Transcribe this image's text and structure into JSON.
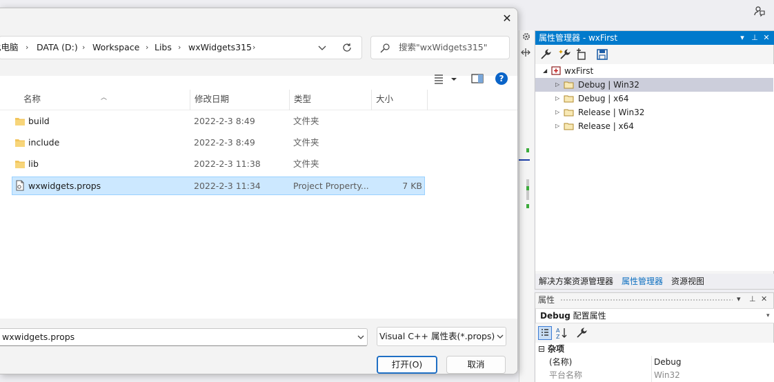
{
  "colors": {
    "accent": "#007acc",
    "selection": "#cce8ff",
    "tree_selection": "#cccedb",
    "folder": "#f2c55c"
  },
  "dialog": {
    "breadcrumbs": [
      "此电脑",
      "DATA (D:)",
      "Workspace",
      "Libs",
      "wxWidgets315"
    ],
    "search_placeholder": "搜索\"wxWidgets315\"",
    "columns": {
      "name": "名称",
      "modified": "修改日期",
      "type": "类型",
      "size": "大小"
    },
    "files": [
      {
        "name": "build",
        "modified": "2022-2-3 8:49",
        "type": "文件夹",
        "size": "",
        "icon": "folder-icon"
      },
      {
        "name": "include",
        "modified": "2022-2-3 8:49",
        "type": "文件夹",
        "size": "",
        "icon": "folder-icon"
      },
      {
        "name": "lib",
        "modified": "2022-2-3 11:38",
        "type": "文件夹",
        "size": "",
        "icon": "folder-icon"
      },
      {
        "name": "wxwidgets.props",
        "modified": "2022-2-3 11:34",
        "type": "Project Property...",
        "size": "7 KB",
        "icon": "file-icon"
      }
    ],
    "filename_value": "wxwidgets.props",
    "filter_value": "Visual C++ 属性表(*.props)",
    "open_label": "打开(O)",
    "cancel_label": "取消"
  },
  "property_manager": {
    "title": "属性管理器 - wxFirst",
    "project": "wxFirst",
    "configs": [
      "Debug | Win32",
      "Debug | x64",
      "Release | Win32",
      "Release | x64"
    ],
    "tabs": [
      "解决方案资源管理器",
      "属性管理器",
      "资源视图"
    ]
  },
  "properties": {
    "title": "属性",
    "object_bold": "Debug",
    "object_rest": "配置属性",
    "category": "杂项",
    "rows": [
      {
        "key": "(名称)",
        "value": "Debug"
      },
      {
        "key": "平台名称",
        "value": "Win32"
      }
    ]
  }
}
